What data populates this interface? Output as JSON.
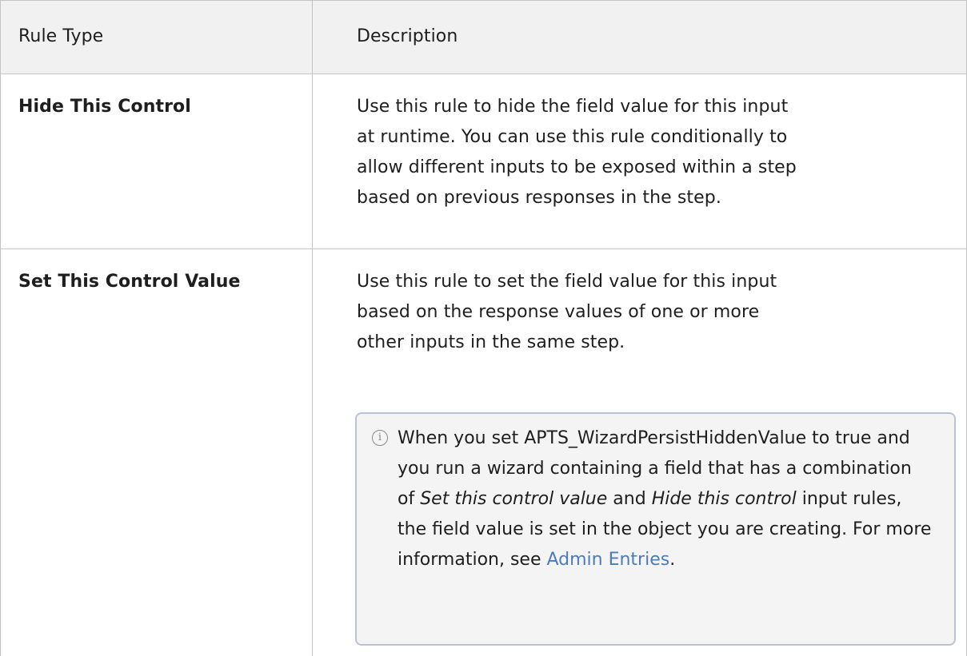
{
  "table": {
    "headers": [
      "Rule Type",
      "Description"
    ],
    "rows": [
      {
        "rule_type": "Hide This Control",
        "description": "Use this rule to hide the field value for this input at runtime. You can use this rule conditionally to allow different inputs to be exposed within a step based on previous responses in the step."
      },
      {
        "rule_type": "Set This Control Value",
        "description": "Use this rule to set the field value for this input based on the response values of one or more other inputs in the same step."
      }
    ]
  },
  "note": {
    "icon": "info-icon",
    "part1": "When you set APTS_WizardPersistHiddenValue to true and you run a wizard containing a field that has a combination of ",
    "em1": "Set this control value",
    "part2": " and ",
    "em2": "Hide this control",
    "part3": " input rules, the field value is set in the object you are creating. For more information, see ",
    "link": "Admin Entries",
    "part4": "."
  }
}
